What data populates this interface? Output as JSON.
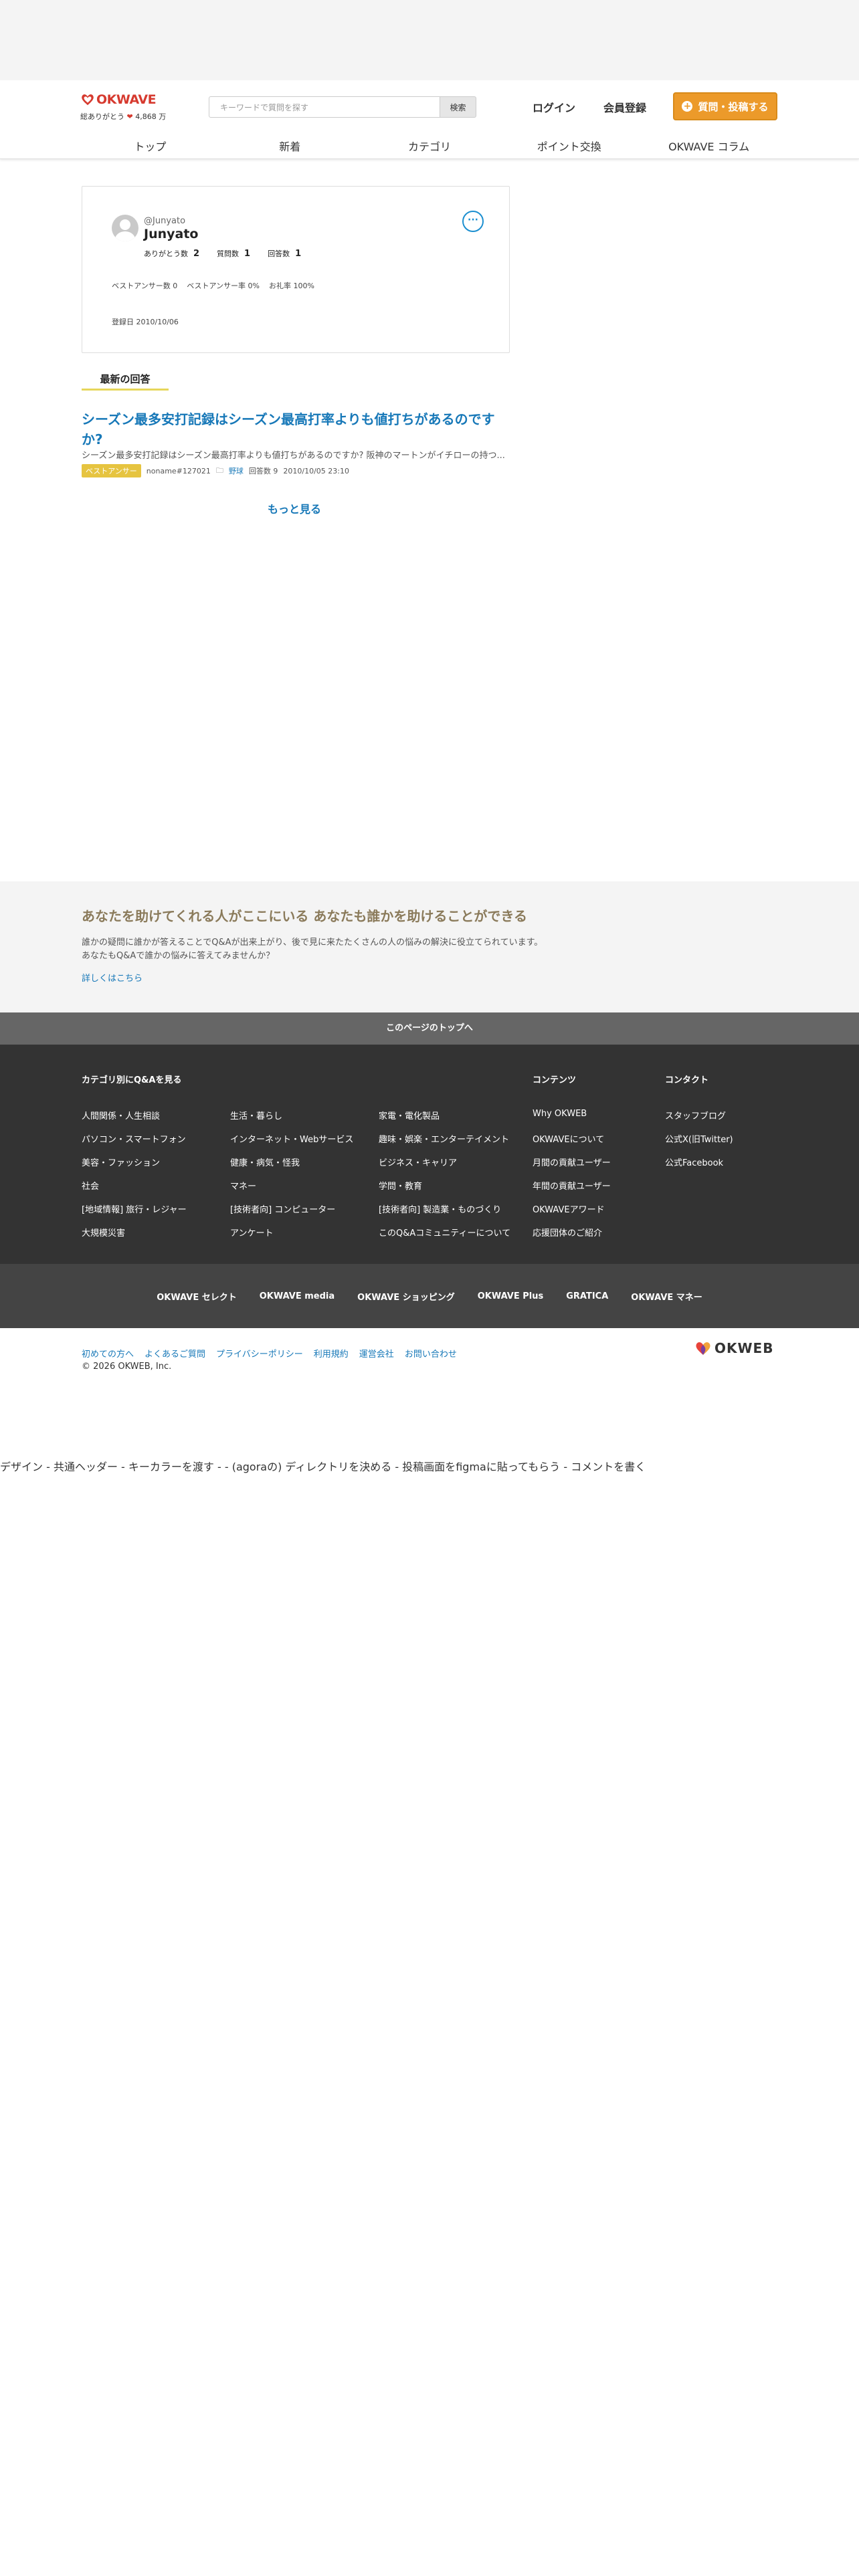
{
  "header": {
    "logo_text": "OKWAVE",
    "logo_sub_prefix": "総ありがとう",
    "logo_sub_heart": "❤",
    "logo_sub_count": "4,868 万",
    "search_placeholder": "キーワードで質問を探す",
    "search_button": "検索",
    "login": "ログイン",
    "register": "会員登録",
    "post_button": "質問・投稿する",
    "brand_color": "#d63a2f",
    "accent_color": "#ec9a2a"
  },
  "nav": {
    "items": [
      "トップ",
      "新着",
      "カテゴリ",
      "ポイント交換",
      "OKWAVE コラム"
    ]
  },
  "profile": {
    "handle": "@Junyato",
    "name": "Junyato",
    "stats": [
      {
        "label": "ありがとう数",
        "value": "2"
      },
      {
        "label": "質問数",
        "value": "1"
      },
      {
        "label": "回答数",
        "value": "1"
      }
    ],
    "rates": [
      "ベストアンサー数 0",
      "ベストアンサー率 0%",
      "お礼率 100%"
    ],
    "joined": "登録日 2010/10/06",
    "more_icon": "more-icon"
  },
  "latest": {
    "section_title": "最新の回答",
    "answer_title": "シーズン最多安打記録はシーズン最高打率よりも値打ちがあるのですか?",
    "excerpt": "シーズン最多安打記録はシーズン最高打率よりも値打ちがあるのですか? 阪神のマートンがイチローの持つ...",
    "badge": "ベストアンサー",
    "author": "noname#127021",
    "category": "野球",
    "answers": "回答数 9",
    "timestamp": "2010/10/05 23:10",
    "more": "もっと見る"
  },
  "help": {
    "title": "あなたを助けてくれる人がここにいる あなたも誰かを助けることができる",
    "text1": "誰かの疑問に誰かが答えることでQ&Aが出来上がり、後で見に来たたくさんの人の悩みの解決に役立てられています。",
    "text2": "あなたもQ&Aで誰かの悩みに答えてみませんか？",
    "link": "詳しくはこちら"
  },
  "footer": {
    "to_top": "このページのトップへ",
    "categories_title": "カテゴリ別にQ&Aを見る",
    "cat_col1": [
      "人間関係・人生相談",
      "パソコン・スマートフォン",
      "美容・ファッション",
      "社会",
      "[地域情報] 旅行・レジャー",
      "大規模災害"
    ],
    "cat_col2": [
      "生活・暮らし",
      "インターネット・Webサービス",
      "健康・病気・怪我",
      "マネー",
      "[技術者向] コンピューター",
      "アンケート"
    ],
    "cat_col3": [
      "家電・電化製品",
      "趣味・娯楽・エンターテイメント",
      "ビジネス・キャリア",
      "学問・教育",
      "[技術者向] 製造業・ものづくり",
      "このQ&Aコミュニティーについて"
    ],
    "contents_title": "コンテンツ",
    "contents": [
      "Why OKWEB",
      "OKWAVEについて",
      "月間の貢献ユーザー",
      "年間の貢献ユーザー",
      "OKWAVEアワード",
      "応援団体のご紹介"
    ],
    "contact_title": "コンタクト",
    "contact": [
      "スタッフブログ",
      "公式X(旧Twitter)",
      "公式Facebook"
    ],
    "services": [
      "OKWAVE セレクト",
      "OKWAVE media",
      "OKWAVE ショッピング",
      "OKWAVE Plus",
      "GRATICA",
      "OKWAVE マネー"
    ],
    "bottom_links": [
      "初めての方へ",
      "よくあるご質問",
      "プライバシーポリシー",
      "利用規約",
      "運営会社",
      "お問い合わせ"
    ],
    "copyright": "© 2026 OKWEB, Inc.",
    "okweb_logo": "OKWEB"
  },
  "caption": "デザイン - 共通ヘッダー - キーカラーを渡す - - (agoraの) ディレクトリを決める - 投稿画面をfigmaに貼ってもらう - コメントを書く"
}
